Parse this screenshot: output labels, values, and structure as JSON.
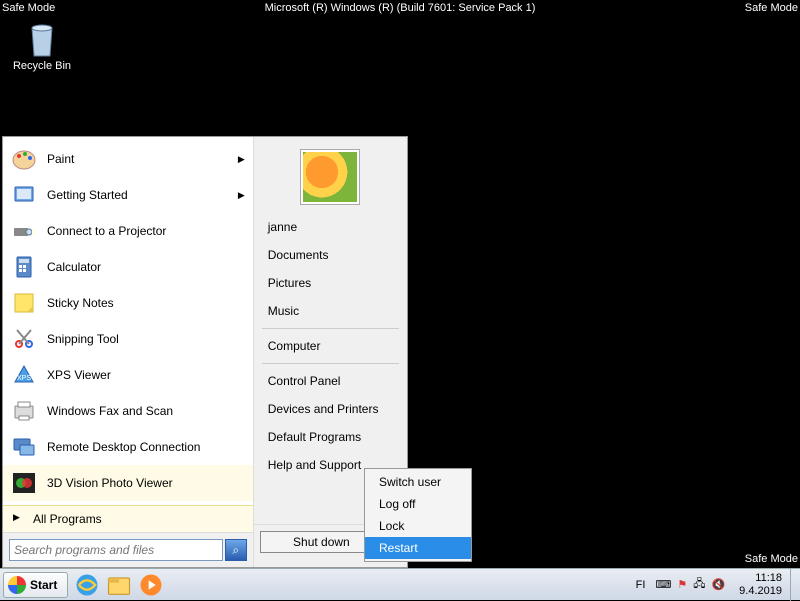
{
  "safe_mode": {
    "corner": "Safe Mode",
    "build": "Microsoft (R) Windows (R) (Build 7601: Service Pack 1)"
  },
  "desktop": {
    "recycle_bin": "Recycle Bin"
  },
  "start_menu": {
    "programs": [
      {
        "label": "Paint",
        "icon": "paint-icon",
        "submenu": true
      },
      {
        "label": "Getting Started",
        "icon": "getting-started-icon",
        "submenu": true
      },
      {
        "label": "Connect to a Projector",
        "icon": "projector-icon"
      },
      {
        "label": "Calculator",
        "icon": "calculator-icon"
      },
      {
        "label": "Sticky Notes",
        "icon": "sticky-notes-icon"
      },
      {
        "label": "Snipping Tool",
        "icon": "snipping-tool-icon"
      },
      {
        "label": "XPS Viewer",
        "icon": "xps-viewer-icon"
      },
      {
        "label": "Windows Fax and Scan",
        "icon": "fax-scan-icon"
      },
      {
        "label": "Remote Desktop Connection",
        "icon": "remote-desktop-icon"
      },
      {
        "label": "3D Vision Photo Viewer",
        "icon": "3d-vision-icon",
        "highlighted": true
      }
    ],
    "all_programs": "All Programs",
    "search_placeholder": "Search programs and files",
    "right": {
      "username": "janne",
      "items_a": [
        "Documents",
        "Pictures",
        "Music"
      ],
      "computer": "Computer",
      "items_b": [
        "Control Panel",
        "Devices and Printers",
        "Default Programs",
        "Help and Support"
      ]
    },
    "shutdown_label": "Shut down"
  },
  "power_menu": {
    "items": [
      "Switch user",
      "Log off",
      "Lock",
      "Restart"
    ],
    "selected": "Restart"
  },
  "taskbar": {
    "start": "Start",
    "lang": "FI",
    "time": "11:18",
    "date": "9.4.2019"
  }
}
